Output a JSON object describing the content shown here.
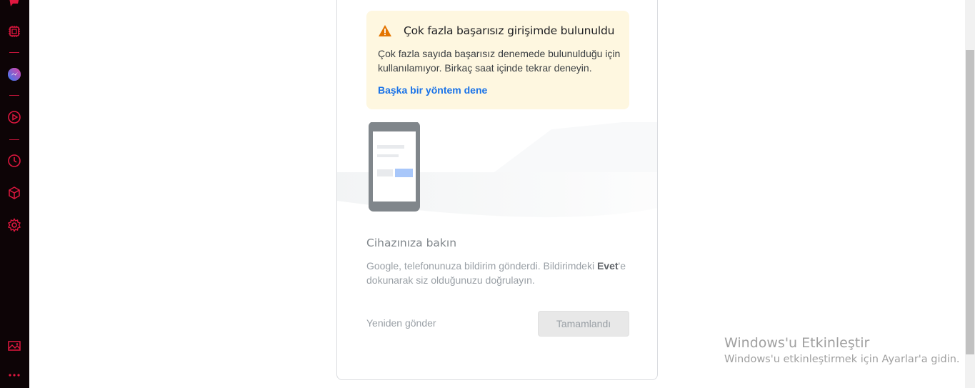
{
  "sidebar": {
    "icons": [
      "opera-logo-icon",
      "extensions-icon",
      "messenger-icon",
      "player-icon",
      "history-icon",
      "crypto-wallet-icon",
      "settings-icon",
      "snapshot-icon",
      "more-icon"
    ],
    "accent": "#e0173f",
    "background": "#0d0406"
  },
  "warning": {
    "title": "Çok fazla başarısız girişimde bulunuldu",
    "body": "Çok fazla sayıda başarısız denemede bulunulduğu için kullanılamıyor. Birkaç saat içinde tekrar deneyin.",
    "link": "Başka bir yöntem dene",
    "icon": "warning-icon",
    "background": "#fef7e0",
    "icon_color": "#e37400"
  },
  "device": {
    "title": "Cihazınıza bakın",
    "body_before": "Google, telefonunuza bildirim gönderdi. Bildirimdeki ",
    "body_bold": "Evet",
    "body_after": "'e dokunarak siz olduğunuzu doğrulayın."
  },
  "actions": {
    "resend": "Yeniden gönder",
    "done": "Tamamlandı"
  },
  "watermark": {
    "title": "Windows'u Etkinleştir",
    "subtitle": "Windows'u etkinleştirmek için Ayarlar'a gidin."
  }
}
